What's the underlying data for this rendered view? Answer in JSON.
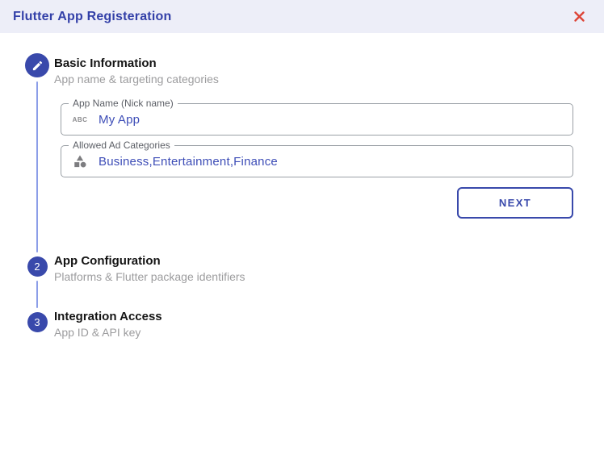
{
  "dialog": {
    "title": "Flutter App Registeration"
  },
  "colors": {
    "primary": "#3949ab",
    "header_bg": "#edeef8",
    "title_text": "#3340a8",
    "connector": "#8c9ee8",
    "value_text": "#3d4db7",
    "close_red": "#dd4437",
    "field_border": "#9aa0a6",
    "subtitle_gray": "#9c9c9e"
  },
  "steps": [
    {
      "number": "1",
      "icon": "edit-pencil",
      "title": "Basic Information",
      "subtitle": "App name & targeting categories",
      "active": true
    },
    {
      "number": "2",
      "title": "App Configuration",
      "subtitle": "Platforms & Flutter package identifiers",
      "active": false
    },
    {
      "number": "3",
      "title": "Integration Access",
      "subtitle": "App ID & API key",
      "active": false
    }
  ],
  "form": {
    "fields": [
      {
        "label": "App Name (Nick name)",
        "value": "My App",
        "icon": "abc-icon",
        "icon_text": "ABC"
      },
      {
        "label": "Allowed Ad Categories",
        "value": "Business,Entertainment,Finance",
        "icon": "category-icon"
      }
    ],
    "next_label": "NEXT"
  }
}
